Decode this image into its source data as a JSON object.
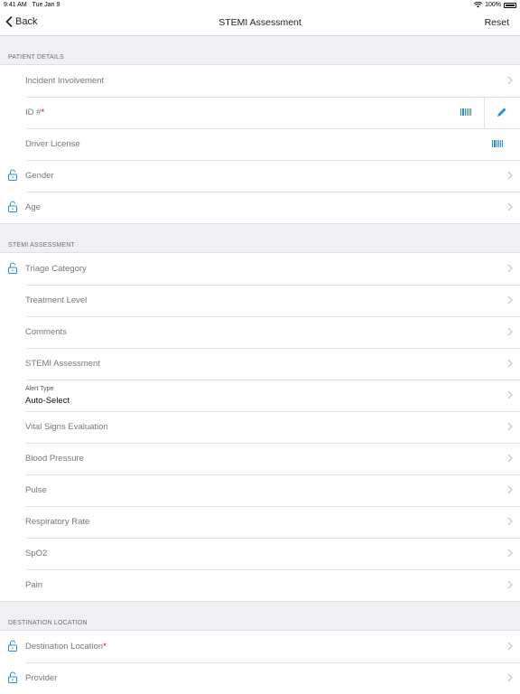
{
  "status_bar": {
    "time": "9:41 AM",
    "date": "Tue Jan 9",
    "battery": "100%"
  },
  "nav": {
    "back_label": "Back",
    "title": "STEMI Assessment",
    "reset_label": "Reset"
  },
  "sections": {
    "patient_details": {
      "header": "PATIENT DETAILS",
      "incident": "Incident Involvement",
      "id_label": "ID #",
      "id_required": "*",
      "driver_license": "Driver License",
      "gender": "Gender",
      "age": "Age"
    },
    "stemi_assessment": {
      "header": "STEMI ASSESSMENT",
      "triage": "Triage Category",
      "treatment": "Treatment Level",
      "comments": "Comments",
      "stemi": "STEMI Assessment",
      "alert_type_label": "Alert Type",
      "alert_type_value": "Auto-Select",
      "vitals": "Vital Signs Evaluation",
      "bp": "Blood Pressure",
      "pulse": "Pulse",
      "resp": "Respiratory Rate",
      "spo2": "SpO2",
      "pain": "Pain"
    },
    "destination": {
      "header": "DESTINATION LOCATION",
      "location": "Destination Location",
      "location_required": "*",
      "provider": "Provider"
    }
  },
  "colors": {
    "accent": "#2a8fd0",
    "required": "#d0021b"
  }
}
